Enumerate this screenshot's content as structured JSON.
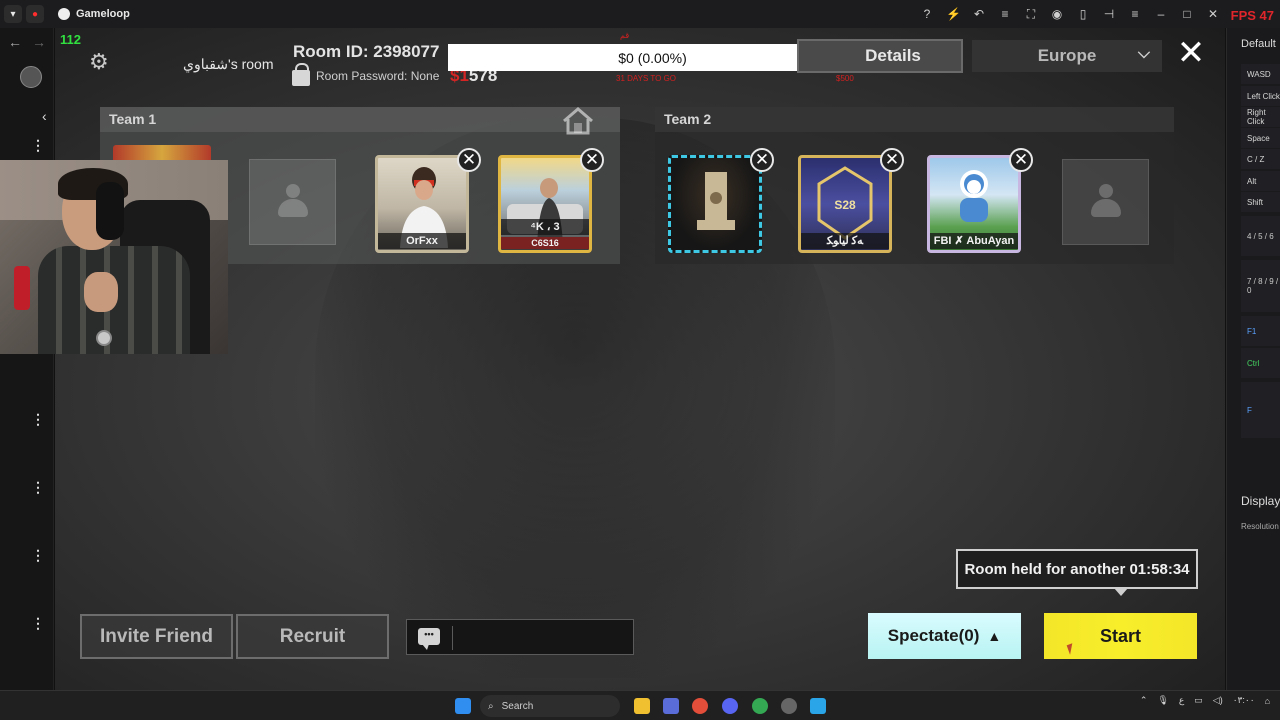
{
  "window": {
    "app_name": "Gameloop",
    "fps_label": "FPS 47",
    "ping": "112"
  },
  "room": {
    "owner": "شقباوي's room",
    "room_id": "Room ID: 2398077",
    "password": "Room Password: None",
    "partial_number_red": "$1",
    "partial_number": "578"
  },
  "goal_bar": {
    "label": "$0 (0.00%)",
    "progress_fraction": 0.0,
    "red_top_text": "قم",
    "red_days_text": "31 DAYS TO GO",
    "red_goal_text": "$500"
  },
  "header": {
    "details_label": "Details",
    "region_label": "Europe"
  },
  "teams": [
    {
      "title": "Team 1",
      "players": [
        {
          "name": "OrFxx"
        },
        {
          "name": "⁴K ، 3"
        }
      ]
    },
    {
      "title": "Team 2",
      "players": [
        {
          "name": ""
        },
        {
          "name": "ﻪﻛ ﻟﻴﺎﻮﻜ"
        },
        {
          "name": "FBI ✗ AbuAyan"
        }
      ]
    }
  ],
  "player_badges": {
    "team1_p2_tag": "C6S16",
    "team2_p2_tag": "S28"
  },
  "bottom": {
    "room_held": "Room held for another 01:58:34",
    "invite_label": "Invite Friend",
    "recruit_label": "Recruit",
    "chat_placeholder": "",
    "spectate_label": "Spectate(0)",
    "start_label": "Start"
  },
  "right_panel": {
    "title": "Default",
    "keys": [
      "WASD",
      "Left Click",
      "Right Click",
      "Space",
      "C / Z",
      "Alt",
      "Shift",
      "4 / 5 / 6",
      "7 / 8 / 9 / 0",
      "F1",
      "Ctrl",
      "F"
    ],
    "display_label": "Display",
    "resolution_label": "Resolution"
  },
  "taskbar": {
    "search_label": "Search",
    "tray_text": "ع"
  },
  "colors": {
    "start_yellow": "#f3e629",
    "spectate_cyan": "#c8f6f6",
    "fps_red": "#e0252b",
    "ping_green": "#31e040"
  }
}
